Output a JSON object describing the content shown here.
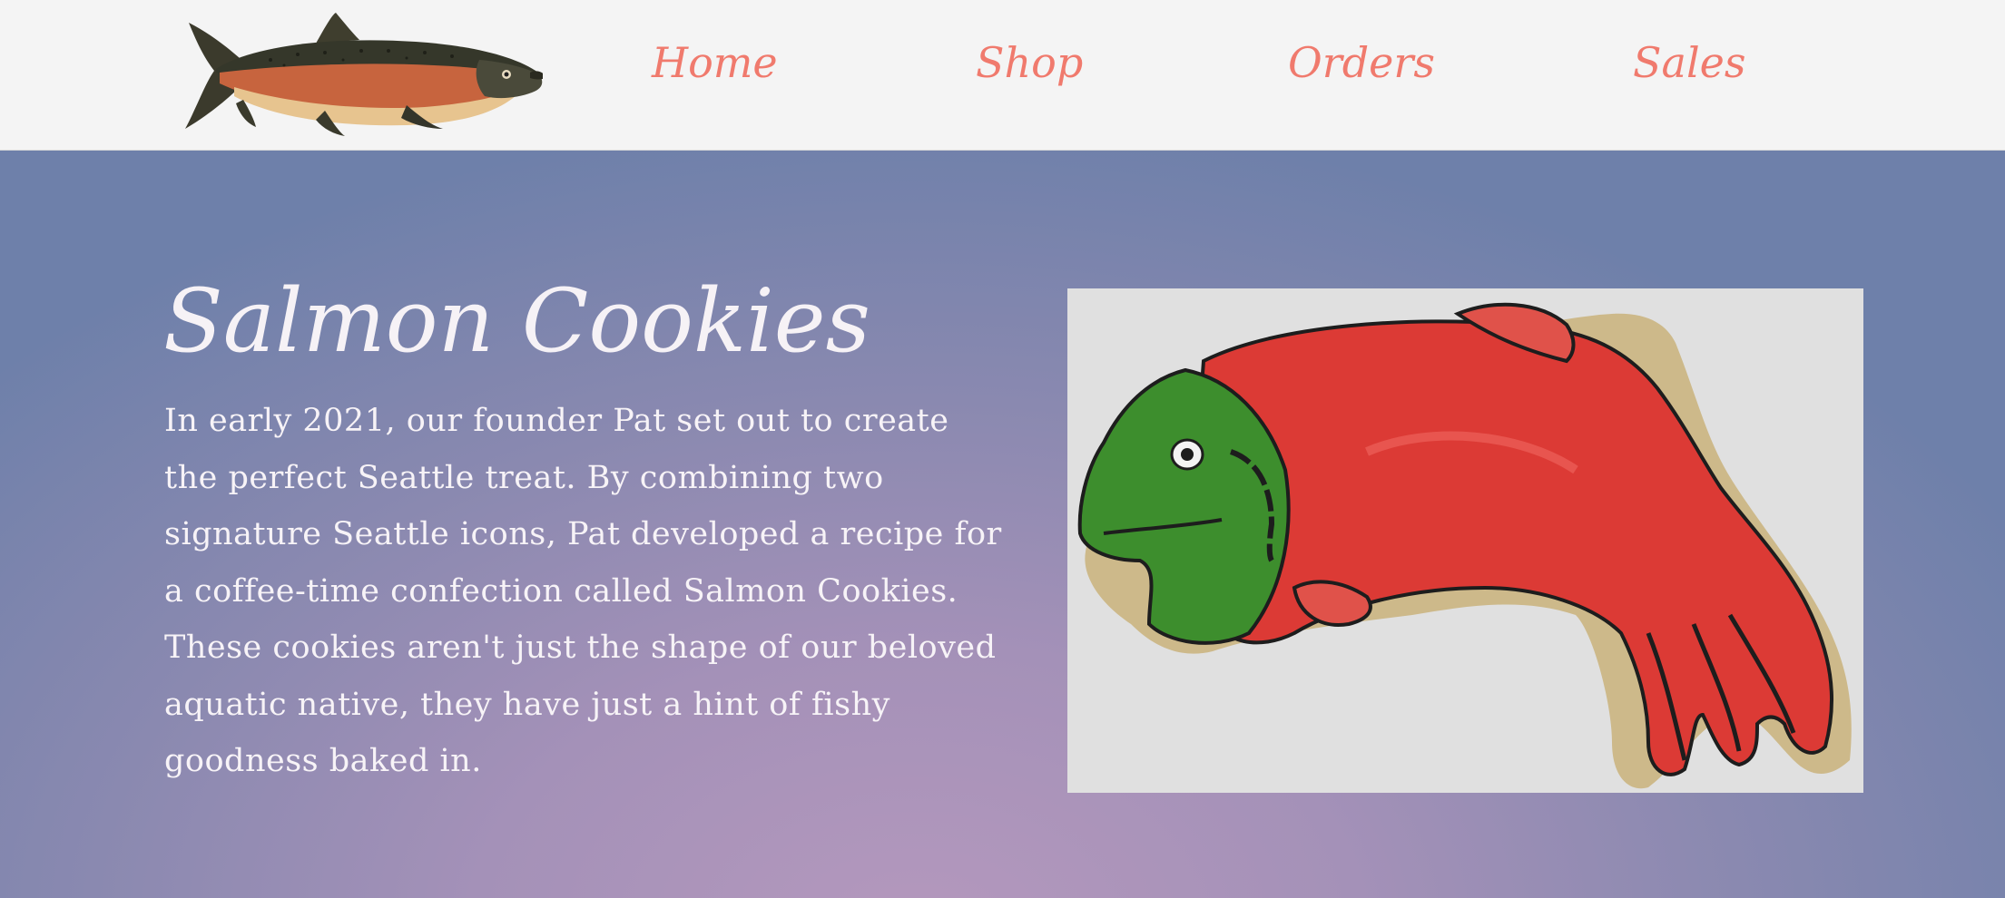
{
  "header": {
    "logo_icon": "salmon-fish-icon",
    "nav": [
      {
        "label": "Home"
      },
      {
        "label": "Shop"
      },
      {
        "label": "Orders"
      },
      {
        "label": "Sales"
      }
    ]
  },
  "hero": {
    "title": "Salmon Cookies",
    "body": "In early 2021, our founder Pat set out to create the perfect Seattle treat. By combining two signature Seattle icons, Pat developed a recipe for a coffee-time confection called Salmon Cookies. These cookies aren't just the shape of our beloved aquatic native, they have just a hint of fishy goodness baked in.",
    "image_icon": "salmon-cookie-image"
  },
  "colors": {
    "nav_text": "#f07a6d",
    "header_bg": "#f4f4f4",
    "hero_gradient_center": "#b498bd",
    "hero_gradient_edge": "#6e80aa",
    "hero_text": "#f7f3f7"
  }
}
